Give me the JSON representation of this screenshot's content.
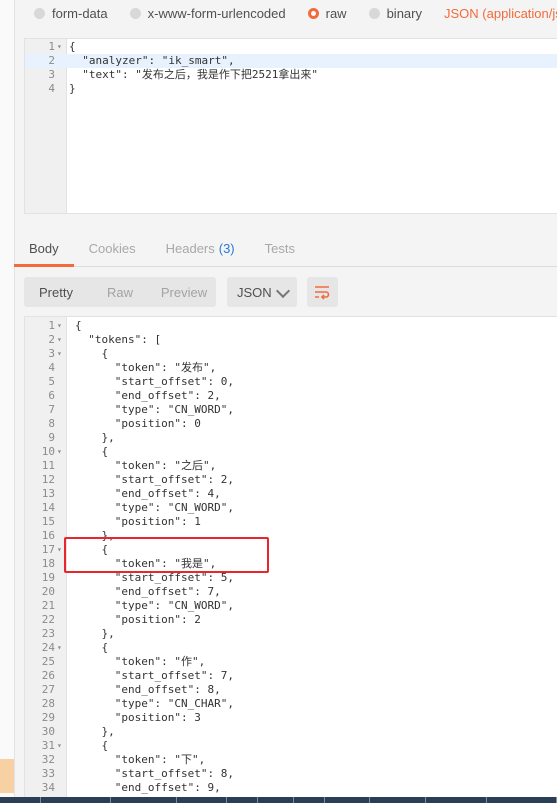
{
  "body_types": [
    {
      "label": "form-data",
      "selected": false
    },
    {
      "label": "x-www-form-urlencoded",
      "selected": false
    },
    {
      "label": "raw",
      "selected": true
    },
    {
      "label": "binary",
      "selected": false
    }
  ],
  "content_type": "JSON (application/json",
  "request_lines": [
    {
      "n": "1",
      "fold": true,
      "text": "{"
    },
    {
      "n": "2",
      "fold": false,
      "text": "  \"analyzer\": \"ik_smart\","
    },
    {
      "n": "3",
      "fold": false,
      "text": "  \"text\": \"发布之后，我是作下把2521拿出来\""
    },
    {
      "n": "4",
      "fold": false,
      "text": "}"
    }
  ],
  "response_tabs": [
    {
      "label": "Body",
      "badge": ""
    },
    {
      "label": "Cookies",
      "badge": ""
    },
    {
      "label": "Headers",
      "badge": "(3)"
    },
    {
      "label": "Tests",
      "badge": ""
    }
  ],
  "view_modes": [
    "Pretty",
    "Raw",
    "Preview"
  ],
  "format": "JSON",
  "response_lines": [
    {
      "n": "1",
      "fold": true,
      "text": "{"
    },
    {
      "n": "2",
      "fold": true,
      "text": "  \"tokens\": ["
    },
    {
      "n": "3",
      "fold": true,
      "text": "    {"
    },
    {
      "n": "4",
      "fold": false,
      "text": "      \"token\": \"发布\","
    },
    {
      "n": "5",
      "fold": false,
      "text": "      \"start_offset\": 0,"
    },
    {
      "n": "6",
      "fold": false,
      "text": "      \"end_offset\": 2,"
    },
    {
      "n": "7",
      "fold": false,
      "text": "      \"type\": \"CN_WORD\","
    },
    {
      "n": "8",
      "fold": false,
      "text": "      \"position\": 0"
    },
    {
      "n": "9",
      "fold": false,
      "text": "    },"
    },
    {
      "n": "10",
      "fold": true,
      "text": "    {"
    },
    {
      "n": "11",
      "fold": false,
      "text": "      \"token\": \"之后\","
    },
    {
      "n": "12",
      "fold": false,
      "text": "      \"start_offset\": 2,"
    },
    {
      "n": "13",
      "fold": false,
      "text": "      \"end_offset\": 4,"
    },
    {
      "n": "14",
      "fold": false,
      "text": "      \"type\": \"CN_WORD\","
    },
    {
      "n": "15",
      "fold": false,
      "text": "      \"position\": 1"
    },
    {
      "n": "16",
      "fold": false,
      "text": "    },"
    },
    {
      "n": "17",
      "fold": true,
      "text": "    {"
    },
    {
      "n": "18",
      "fold": false,
      "text": "      \"token\": \"我是\","
    },
    {
      "n": "19",
      "fold": false,
      "text": "      \"start_offset\": 5,"
    },
    {
      "n": "20",
      "fold": false,
      "text": "      \"end_offset\": 7,"
    },
    {
      "n": "21",
      "fold": false,
      "text": "      \"type\": \"CN_WORD\","
    },
    {
      "n": "22",
      "fold": false,
      "text": "      \"position\": 2"
    },
    {
      "n": "23",
      "fold": false,
      "text": "    },"
    },
    {
      "n": "24",
      "fold": true,
      "text": "    {"
    },
    {
      "n": "25",
      "fold": false,
      "text": "      \"token\": \"作\","
    },
    {
      "n": "26",
      "fold": false,
      "text": "      \"start_offset\": 7,"
    },
    {
      "n": "27",
      "fold": false,
      "text": "      \"end_offset\": 8,"
    },
    {
      "n": "28",
      "fold": false,
      "text": "      \"type\": \"CN_CHAR\","
    },
    {
      "n": "29",
      "fold": false,
      "text": "      \"position\": 3"
    },
    {
      "n": "30",
      "fold": false,
      "text": "    },"
    },
    {
      "n": "31",
      "fold": true,
      "text": "    {"
    },
    {
      "n": "32",
      "fold": false,
      "text": "      \"token\": \"下\","
    },
    {
      "n": "33",
      "fold": false,
      "text": "      \"start_offset\": 8,"
    },
    {
      "n": "34",
      "fold": false,
      "text": "      \"end_offset\": 9,"
    }
  ],
  "colors": {
    "accent": "#f26b3a",
    "highlight_box": "#e8262e",
    "badge": "#2a7ad5"
  },
  "icons": {
    "wrap": "wrap-lines-icon",
    "chevron": "chevron-down-icon"
  }
}
